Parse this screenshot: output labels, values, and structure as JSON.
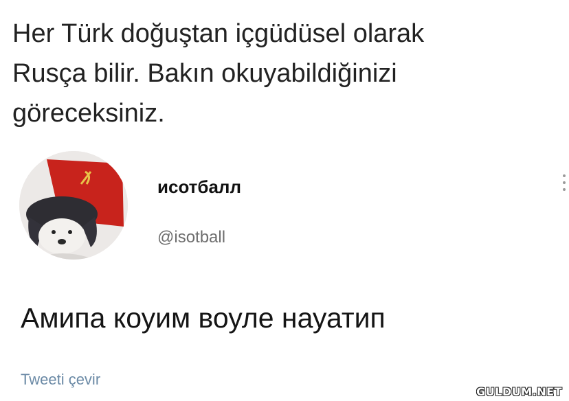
{
  "caption": {
    "lines": [
      "Her Türk doğuştan içgüdüsel olarak",
      "Rusça bilir. Bakın okuyabildiğinizi",
      "göreceksiniz."
    ]
  },
  "tweet": {
    "author": {
      "display_name": "исотбалл",
      "handle": "@isotball",
      "avatar_icon": "dog-in-ushanka-avatar"
    },
    "more_icon": "vertical-dots-icon",
    "text": "Амипа коуим воуле науатип",
    "translate_label": "Tweeti çevir"
  },
  "watermark": {
    "text": "GULDUM.NET"
  },
  "colors": {
    "handle": "#6e6e6e",
    "translate_link": "#6b8aa6",
    "flag_red": "#c8231c",
    "hat_dark": "#2e2d33"
  }
}
